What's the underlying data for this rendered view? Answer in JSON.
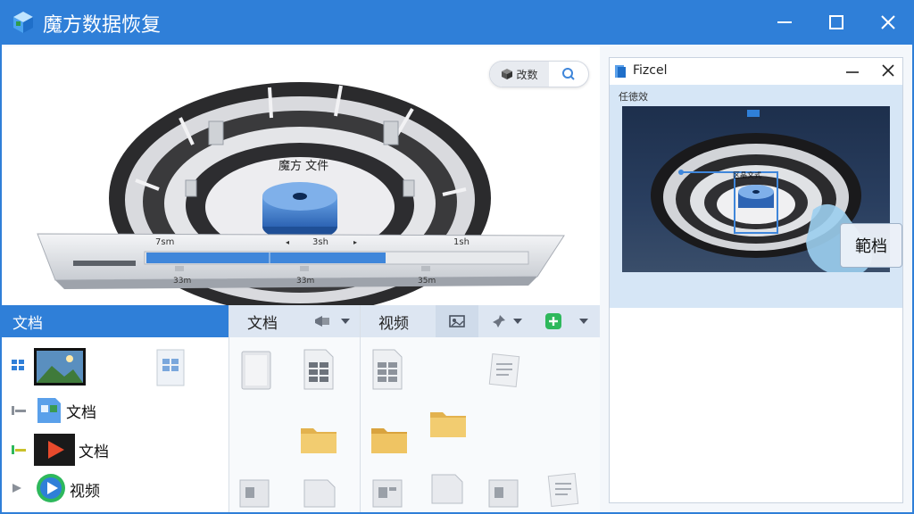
{
  "app": {
    "title": "魔方数据恢复"
  },
  "illustration": {
    "hub_label": "魔方 文件",
    "ruler_labels": [
      "7sm",
      "3sh",
      "1sh"
    ],
    "ruler_sub_labels": [
      "33m",
      "33m",
      "35m"
    ],
    "search_pill_label": "改数"
  },
  "preview": {
    "title": "Fizcel",
    "subtitle": "任徳效",
    "screen_label": "区晶文式",
    "badge": "範档"
  },
  "left_pane": {
    "header": "文档",
    "items": [
      {
        "label": ""
      },
      {
        "label": "文档"
      },
      {
        "label": "文档"
      },
      {
        "label": "视频"
      }
    ]
  },
  "mid_pane": {
    "header": "文档"
  },
  "right_pane": {
    "header": "视频"
  },
  "colors": {
    "accent": "#2f7fd8",
    "header_bg": "#dde6f2",
    "folder": "#e9c46a",
    "add_green": "#2eb85c"
  }
}
